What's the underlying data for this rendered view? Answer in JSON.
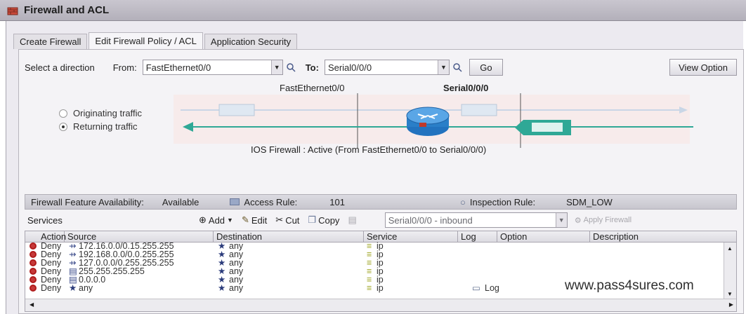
{
  "window": {
    "title": "Firewall and ACL"
  },
  "tabs": [
    {
      "label": "Create Firewall"
    },
    {
      "label": "Edit Firewall Policy / ACL"
    },
    {
      "label": "Application Security"
    }
  ],
  "direction": {
    "label": "Select a direction",
    "from_label": "From:",
    "from_value": "FastEthernet0/0",
    "to_label": "To:",
    "to_value": "Serial0/0/0",
    "go_button": "Go",
    "view_option_button": "View Option"
  },
  "diagram": {
    "left_interface": "FastEthernet0/0",
    "right_interface": "Serial0/0/0",
    "radio_originating": "Originating traffic",
    "radio_returning": "Returning traffic",
    "selected": "returning",
    "status": "IOS Firewall : Active (From FastEthernet0/0 to Serial0/0/0)"
  },
  "features": {
    "label": "Firewall Feature Availability:",
    "availability": "Available",
    "access_rule_label": "Access Rule:",
    "access_rule_value": "101",
    "inspection_label": "Inspection Rule:",
    "inspection_value": "SDM_LOW"
  },
  "toolbar": {
    "services": "Services",
    "add": "Add",
    "edit": "Edit",
    "cut": "Cut",
    "copy": "Copy",
    "interface_select": "Serial0/0/0 - inbound",
    "apply": "Apply Firewall"
  },
  "grid": {
    "headers": [
      "Action",
      "Source",
      "Destination",
      "Service",
      "Log",
      "Option",
      "Description"
    ],
    "rows": [
      {
        "action": "Deny",
        "source": "172.16.0.0/0.15.255.255",
        "destination": "any",
        "service": "ip",
        "log": ""
      },
      {
        "action": "Deny",
        "source": "192.168.0.0/0.0.255.255",
        "destination": "any",
        "service": "ip",
        "log": ""
      },
      {
        "action": "Deny",
        "source": "127.0.0.0/0.255.255.255",
        "destination": "any",
        "service": "ip",
        "log": ""
      },
      {
        "action": "Deny",
        "source": "255.255.255.255",
        "destination": "any",
        "service": "ip",
        "log": ""
      },
      {
        "action": "Deny",
        "source": "0.0.0.0",
        "destination": "any",
        "service": "ip",
        "log": ""
      },
      {
        "action": "Deny",
        "source": "any",
        "destination": "any",
        "service": "ip",
        "log": "Log"
      }
    ]
  },
  "watermark": "www.pass4sures.com",
  "colors": {
    "accent_arrow": "#2fa896",
    "deny": "#c63a3a",
    "router": "#2a7fc8"
  }
}
